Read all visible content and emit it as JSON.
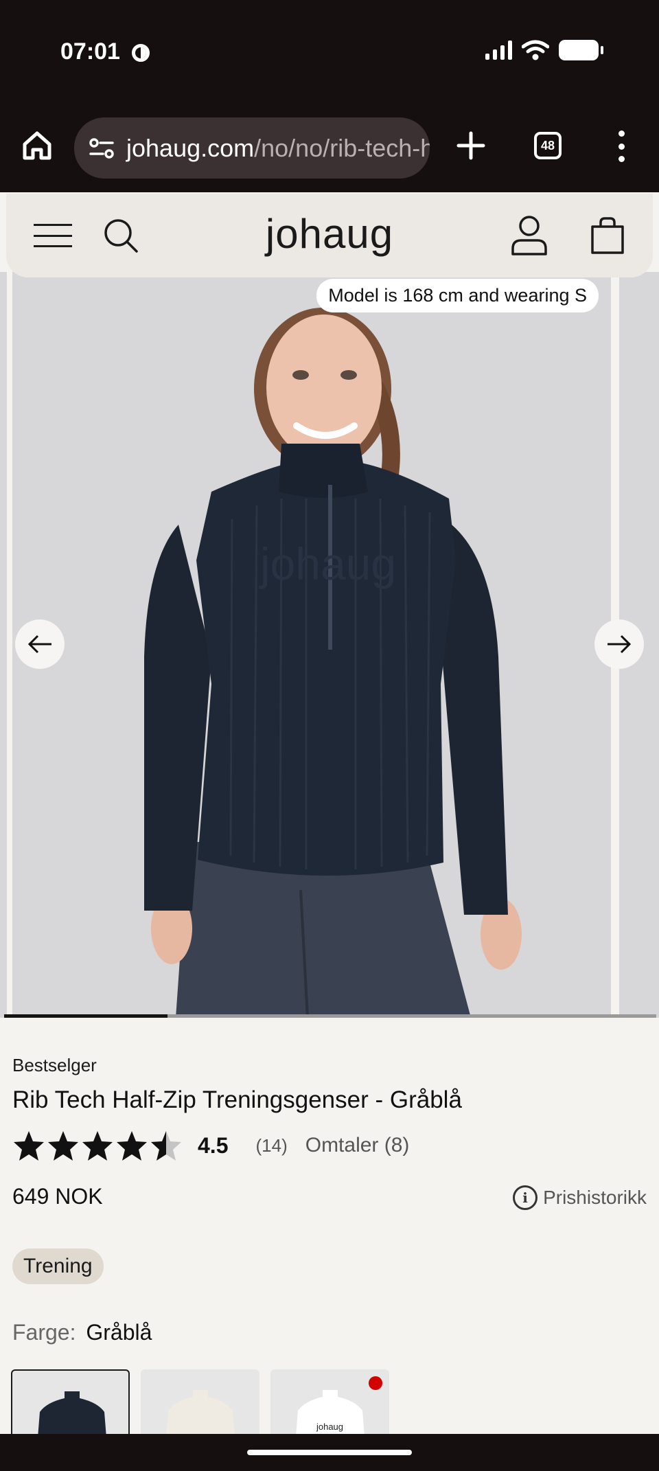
{
  "status_bar": {
    "time": "07:01"
  },
  "browser": {
    "url_domain": "johaug.com",
    "url_path": "/no/no/rib-tech-half-zip-treningsgenser-grabla",
    "tab_count": "48"
  },
  "site": {
    "logo": "johaug"
  },
  "gallery": {
    "model_note": "Model is 168 cm and wearing S",
    "progress_fraction": 0.25,
    "shirt_print": "johaug"
  },
  "product": {
    "badge": "Bestselger",
    "title": "Rib Tech Half-Zip Treningsgenser - Gråblå",
    "rating": "4.5",
    "rating_fraction": 0.9,
    "rating_count": "(14)",
    "reviews_label": "Omtaler (8)",
    "price": "649 NOK",
    "price_history_label": "Prishistorikk",
    "category": "Trening",
    "color_label": "Farge:",
    "color_value": "Gråblå",
    "swatches": [
      {
        "color": "#1e2633",
        "selected": true
      },
      {
        "color": "#efeae2",
        "selected": false
      },
      {
        "color": "#ffffff",
        "selected": false,
        "new_dot": true,
        "label": "johaug"
      }
    ]
  },
  "colors": {
    "system_bar": "#150f10",
    "page_bg": "#f4f3f0",
    "header_bg": "#ece9e4",
    "chip_bg": "#e0d9cf",
    "new_dot": "#d30000"
  }
}
